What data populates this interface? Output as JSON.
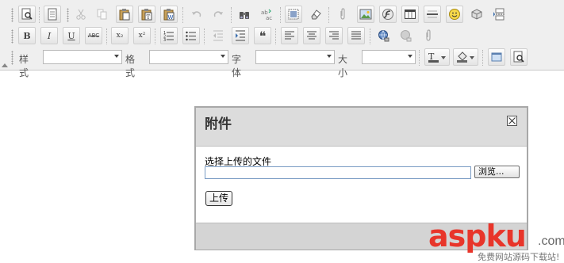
{
  "toolbar": {
    "style_label": "样式",
    "format_label": "格式",
    "font_label": "字体",
    "size_label": "大小",
    "style_value": "",
    "format_value": "",
    "font_value": "",
    "size_value": "",
    "bold_glyph": "B",
    "italic_glyph": "I",
    "underline_glyph": "U",
    "strike_glyph": "ABC",
    "subscript_glyph": "x₂",
    "superscript_glyph": "x²",
    "blockquote_glyph": "❝"
  },
  "dialog": {
    "title": "附件",
    "file_label": "选择上传的文件",
    "file_value": "",
    "browse_label": "浏览...",
    "upload_label": "上传"
  },
  "watermark": {
    "brand": "aspku",
    "domain_suffix": ".com",
    "subtitle": "免费网站源码下载站!"
  },
  "colors": {
    "toolbar_bg": "#efefef",
    "dialog_header_bg": "#dcdcdc",
    "dialog_footer_bg": "#d4d4d4",
    "watermark_red": "#e8352a"
  }
}
